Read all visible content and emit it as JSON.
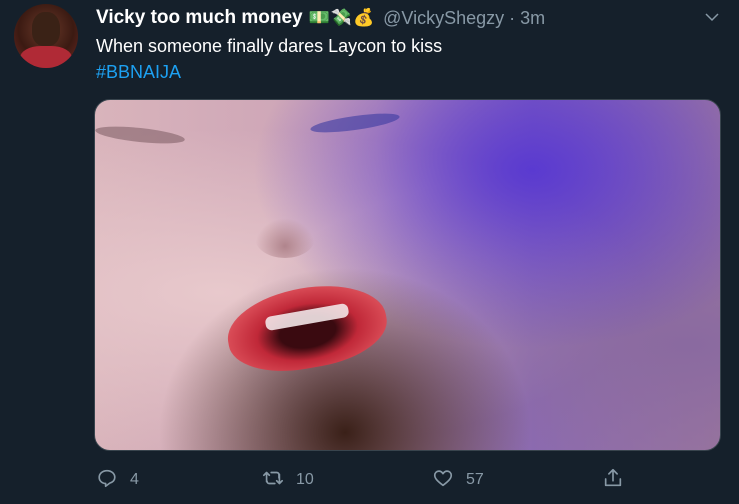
{
  "tweet": {
    "display_name": "Vicky too much money",
    "name_emojis": "💵💸💰",
    "handle": "@VickyShegzy",
    "separator": "·",
    "time": "3m",
    "text": "When someone finally dares Laycon to kiss",
    "hashtag": "#BBNAIJA"
  },
  "actions": {
    "reply_count": "4",
    "retweet_count": "10",
    "like_count": "57"
  },
  "icons": {
    "caret": "chevron-down-icon",
    "reply": "reply-icon",
    "retweet": "retweet-icon",
    "like": "heart-icon",
    "share": "share-icon"
  },
  "colors": {
    "background": "#15202b",
    "secondary_text": "#8899a6",
    "link": "#1da1f2"
  }
}
